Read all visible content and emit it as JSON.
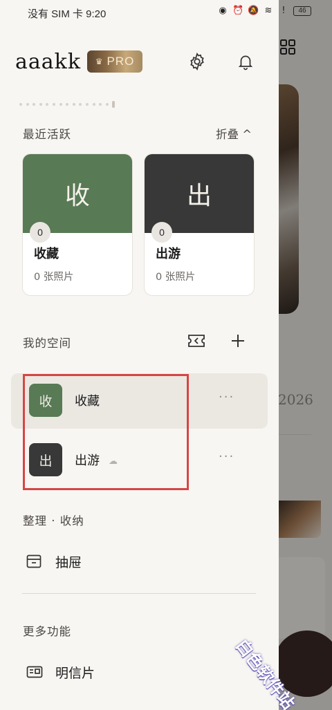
{
  "status_bar": {
    "time": "没有 SIM 卡 9:20",
    "battery": "46"
  },
  "header": {
    "brand": "aaakk",
    "badge": "PRO",
    "settings_icon": "gear-icon",
    "notifications_icon": "bell-icon"
  },
  "recent": {
    "title": "最近活跃",
    "collapse_label": "折叠 ^",
    "cards": [
      {
        "cover_char": "收",
        "count": "0",
        "name": "收藏",
        "subtitle": "0 张照片",
        "color": "#587a55"
      },
      {
        "cover_char": "出",
        "count": "0",
        "name": "出游",
        "subtitle": "0 张照片",
        "color": "#383838"
      }
    ]
  },
  "my_space": {
    "title": "我的空间",
    "items": [
      {
        "thumb_char": "收",
        "name": "收藏",
        "more": "···",
        "color": "#587a55"
      },
      {
        "thumb_char": "出",
        "name": "出游",
        "more": "···",
        "color": "#383838"
      }
    ]
  },
  "organize": {
    "title": "整理 · 收纳",
    "items": [
      {
        "label": "抽屉",
        "icon": "drawer-icon"
      }
    ]
  },
  "more": {
    "title": "更多功能",
    "items": [
      {
        "label": "明信片",
        "icon": "postcard-icon"
      }
    ]
  },
  "background": {
    "year": "2026"
  },
  "watermark": "白色软件站",
  "colors": {
    "highlight_border": "#d64545",
    "drawer_bg": "#f8f6f2"
  }
}
